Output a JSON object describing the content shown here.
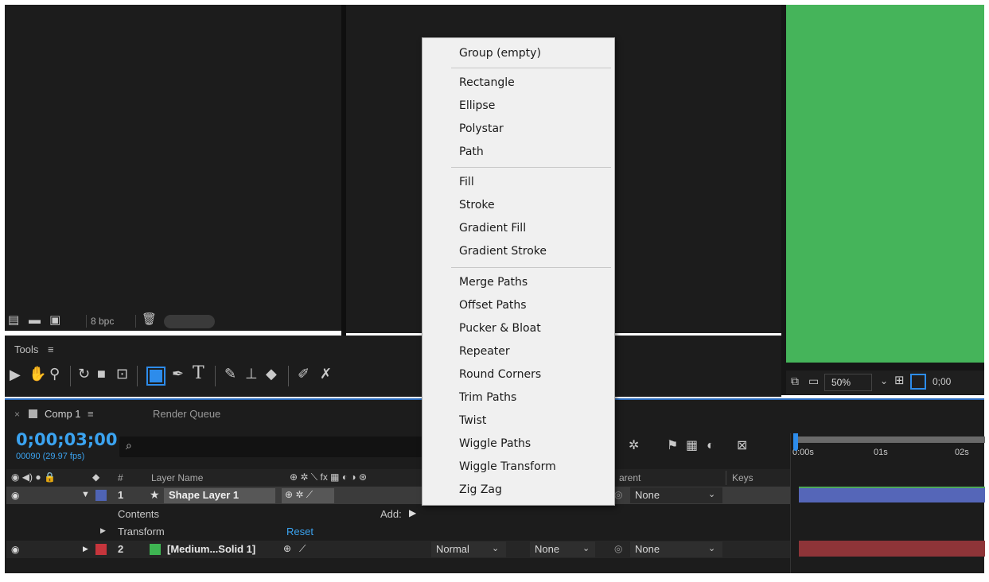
{
  "colors": {
    "bg_panel": "#1c1c1c",
    "accent_blue": "#2d8ceb",
    "timecode": "#3ba3f0",
    "green_preview": "#45b45a",
    "layer1_color": "#4f64b5",
    "layer2_color": "#c6353c",
    "solid_swatch": "#3eb552"
  },
  "project_footer": {
    "bpc": "8 bpc"
  },
  "tools": {
    "title": "Tools",
    "menu_icon": "hamburger-icon"
  },
  "viewer_footer": {
    "zoom": "50%",
    "timecode_fragment": "0;00"
  },
  "context_menu": {
    "groups": [
      [
        "Group (empty)"
      ],
      [
        "Rectangle",
        "Ellipse",
        "Polystar",
        "Path"
      ],
      [
        "Fill",
        "Stroke",
        "Gradient Fill",
        "Gradient Stroke"
      ],
      [
        "Merge Paths",
        "Offset Paths",
        "Pucker & Bloat",
        "Repeater",
        "Round Corners",
        "Trim Paths",
        "Twist",
        "Wiggle Paths",
        "Wiggle Transform",
        "Zig Zag"
      ]
    ]
  },
  "timeline": {
    "tab_close": "×",
    "comp_tab": "Comp 1",
    "tab_menu": "≡",
    "render_queue_tab": "Render Queue",
    "timecode": "0;00;03;00",
    "frames": "00090 (29.97 fps)",
    "search_icon": "⌕",
    "col_hash": "#",
    "col_layer_name": "Layer Name",
    "col_parent_partial": "arent",
    "col_keys": "Keys",
    "ruler": [
      "0:00s",
      "01s",
      "02s"
    ],
    "layers": [
      {
        "num": "1",
        "name": "Shape Layer 1",
        "parent": "None"
      },
      {
        "num": "2",
        "name": "[Medium...Solid 1]",
        "mode": "Normal",
        "trkmat": "None",
        "parent": "None"
      }
    ],
    "contents_label": "Contents",
    "add_label": "Add:",
    "transform_label": "Transform",
    "reset_label": "Reset"
  }
}
